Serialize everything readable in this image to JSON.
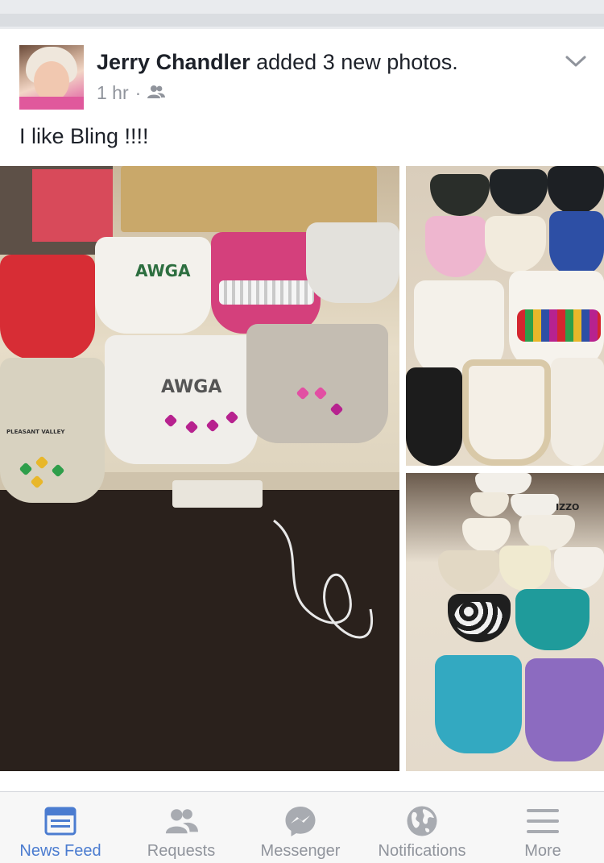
{
  "post": {
    "author": "Jerry Chandler",
    "action": "added 3 new photos.",
    "time": "1 hr",
    "separator": "·",
    "audience_icon": "friends-icon",
    "text": "I like Bling !!!!",
    "photos": [
      {
        "visible_text": [
          "AWGA",
          "AWGA",
          "PLEASANT VALLEY"
        ]
      },
      {
        "visible_text": []
      },
      {
        "visible_text": [
          "IZZO"
        ]
      }
    ]
  },
  "tabbar": {
    "tabs": [
      {
        "label": "News Feed",
        "icon": "news-feed-icon",
        "active": true
      },
      {
        "label": "Requests",
        "icon": "requests-icon",
        "active": false
      },
      {
        "label": "Messenger",
        "icon": "messenger-icon",
        "active": false
      },
      {
        "label": "Notifications",
        "icon": "globe-icon",
        "active": false
      },
      {
        "label": "More",
        "icon": "menu-icon",
        "active": false
      }
    ]
  },
  "colors": {
    "accent": "#4b7cd0",
    "inactive": "#90949c",
    "text": "#1d2129"
  }
}
